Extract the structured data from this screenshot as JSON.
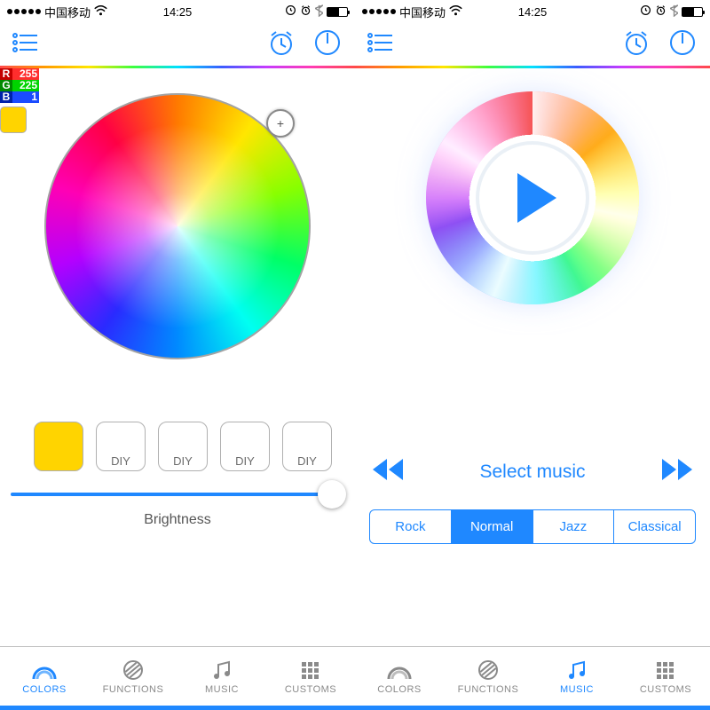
{
  "status": {
    "carrier": "中国移动",
    "time": "14:25",
    "wifi_icon": "wifi",
    "lock_icon": "rotation-lock",
    "alarm_icon": "alarm",
    "bt_icon": "bluetooth"
  },
  "rgb": {
    "r": "255",
    "g": "225",
    "b": "1"
  },
  "presets": {
    "preset1_label": "",
    "preset2_label": "DIY",
    "preset3_label": "DIY",
    "preset4_label": "DIY",
    "preset5_label": "DIY"
  },
  "brightness_label": "Brightness",
  "music": {
    "select_label": "Select music",
    "genres": {
      "g1": "Rock",
      "g2": "Normal",
      "g3": "Jazz",
      "g4": "Classical"
    }
  },
  "tabs": {
    "colors": "COLORS",
    "functions": "FUNCTIONS",
    "music": "MUSIC",
    "customs": "CUSTOMS"
  }
}
